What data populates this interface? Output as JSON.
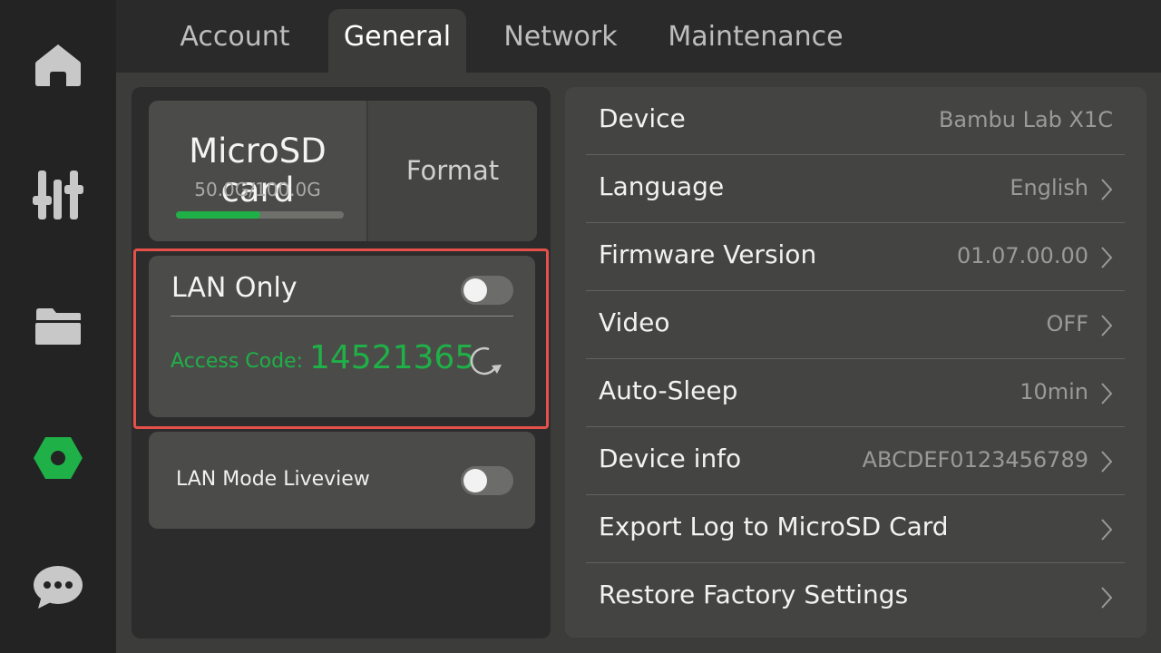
{
  "sidebar": {
    "items": [
      {
        "icon": "home-icon",
        "color": "#c8c8c8"
      },
      {
        "icon": "sliders-icon",
        "color": "#c8c8c8"
      },
      {
        "icon": "folder-icon",
        "color": "#c8c8c8"
      },
      {
        "icon": "settings-hex-icon",
        "color": "#1fb047",
        "active": true
      },
      {
        "icon": "chat-icon",
        "color": "#c8c8c8"
      }
    ]
  },
  "tabs": [
    {
      "label": "Account",
      "active": false
    },
    {
      "label": "General",
      "active": true
    },
    {
      "label": "Network",
      "active": false
    },
    {
      "label": "Maintenance",
      "active": false
    }
  ],
  "storage": {
    "title": "MicroSD card",
    "usage": "50.0G/100.0G",
    "used_fraction": 0.5,
    "format_label": "Format"
  },
  "lan": {
    "label": "LAN Only",
    "enabled": false,
    "access_label": "Access Code:",
    "access_code": "14521365"
  },
  "liveview": {
    "label": "LAN Mode Liveview",
    "enabled": false
  },
  "settings": [
    {
      "label": "Device",
      "value": "Bambu Lab X1C",
      "chevron": false
    },
    {
      "label": "Language",
      "value": "English",
      "chevron": true
    },
    {
      "label": "Firmware Version",
      "value": "01.07.00.00",
      "chevron": true
    },
    {
      "label": "Video",
      "value": "OFF",
      "chevron": true
    },
    {
      "label": "Auto-Sleep",
      "value": "10min",
      "chevron": true
    },
    {
      "label": "Device info",
      "value": "ABCDEF0123456789",
      "chevron": true
    },
    {
      "label": "Export Log to MicroSD Card",
      "value": "",
      "chevron": true
    },
    {
      "label": "Restore Factory Settings",
      "value": "",
      "chevron": true
    }
  ],
  "colors": {
    "accent": "#1fb047",
    "highlight": "#e5514a"
  }
}
